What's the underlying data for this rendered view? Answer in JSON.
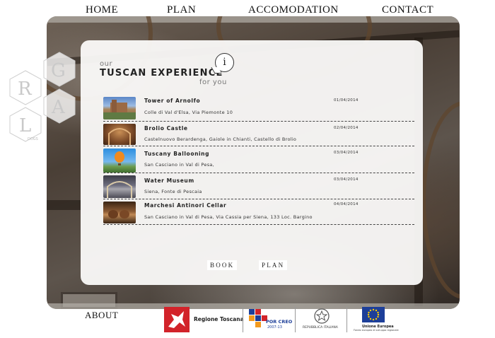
{
  "nav": {
    "items": [
      {
        "id": "home",
        "label": "HOME"
      },
      {
        "id": "plan",
        "label": "PLAN"
      },
      {
        "id": "accommodation",
        "label": "ACCOMODATION"
      },
      {
        "id": "contact",
        "label": "CONTACT"
      }
    ]
  },
  "logo": {
    "letters": [
      "R",
      "G",
      "A",
      "L"
    ],
    "tag": "DOGS"
  },
  "panel": {
    "title_our": "our",
    "title_main": "TUSCAN EXPERIENCE",
    "title_for": "for you",
    "info_icon": "i"
  },
  "experiences": [
    {
      "name": "Tower of Arnolfo",
      "address": "Colle di Val d'Elsa, Via Piemonte 10",
      "date": "01/04/2014",
      "thumb": "tower-photo"
    },
    {
      "name": "Brolio Castle",
      "address": "Castelnuovo Berardenga, Gaiole in Chianti, Castello di Brolio",
      "date": "02/04/2014",
      "thumb": "castle-photo"
    },
    {
      "name": "Tuscany Ballooning",
      "address": "San Casciano in Val di Pesa,",
      "date": "03/04/2014",
      "thumb": "balloon-photo"
    },
    {
      "name": "Water Museum",
      "address": "Siena, Fonte di Pescaia",
      "date": "03/04/2014",
      "thumb": "museum-photo"
    },
    {
      "name": "Marchesi Antinori Cellar",
      "address": "San Casciano in Val di Pesa, Via Cassia per Siena, 133 Loc. Bargino",
      "date": "04/04/2014",
      "thumb": "cellar-photo"
    }
  ],
  "buttons": {
    "book": "BOOK",
    "plan": "PLAN"
  },
  "footer": {
    "about": "ABOUT",
    "partners": {
      "regione": "Regione Toscana",
      "por": "POR CREO",
      "por_years": "2007-13",
      "repubblica": "REPUBBLICA ITALIANA",
      "ue": "Unione Europea",
      "ue_sub": "Fondo europeo di sviluppo regionale"
    }
  },
  "colors": {
    "panel": "#fbfaf9",
    "text": "#222222",
    "regione_red": "#d2232a",
    "eu_blue": "#1d3f99",
    "eu_gold": "#ffcc00"
  }
}
